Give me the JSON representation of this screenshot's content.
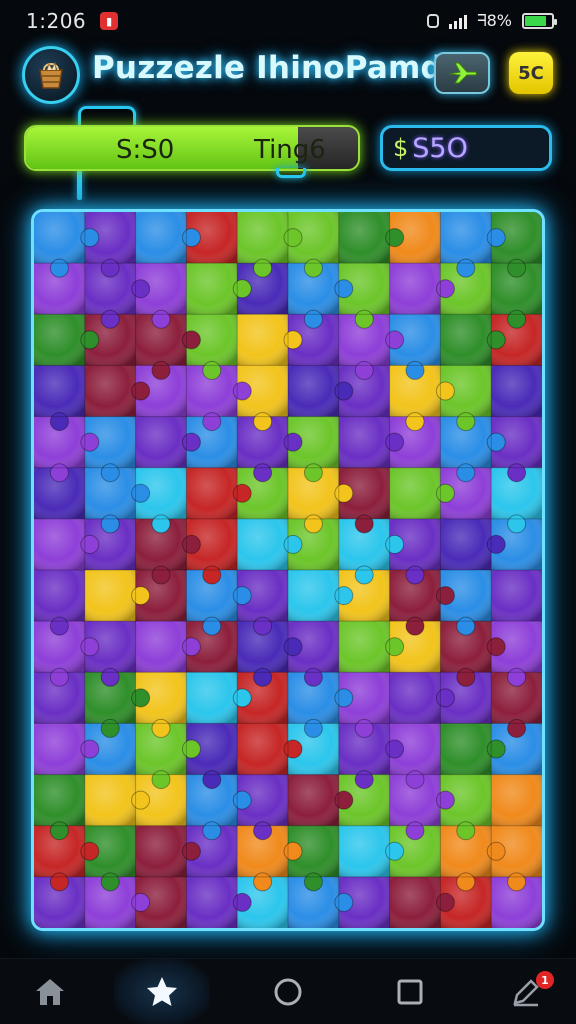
{
  "status_bar": {
    "time": "1:206",
    "notification_icon": "alert-badge-icon",
    "battery_text": "ᖷ8%",
    "battery_level": 0.8
  },
  "header": {
    "app_icon": "bucket-icon",
    "title": "Puzzezle IhinoPamd",
    "next_button_icon": "airplane-icon",
    "coin_label": "5C"
  },
  "progress": {
    "fill_fraction": 0.82,
    "score_label": "S:S0",
    "timer_label": "Ting6"
  },
  "money": {
    "symbol": "$",
    "amount": "S5O"
  },
  "board": {
    "rows": 12,
    "cols": 10,
    "palette": {
      "P": "#6a2fc4",
      "V": "#8e3fd8",
      "B": "#2b8ee6",
      "C": "#2cc6ec",
      "G": "#6cc62a",
      "D": "#2f8f2a",
      "Y": "#f2c41c",
      "O": "#f08a1c",
      "R": "#c62626",
      "M": "#8c1f3c",
      "I": "#4a2bb8"
    },
    "pieces": [
      "BPBRGGDOBD",
      "VPVGIBGVGD",
      "DMMGYPVBDR",
      "IMVVYIPYGI",
      "VBPBPGPVBP",
      "IBCRGYMGVC",
      "VPMRCGCPIB",
      "PYMBPCYMBP",
      "VPVMIPGYMV",
      "PDYCRBVPPM",
      "VBGIRCPVDB",
      "DYYBPMGVGO",
      "RDMPODCGOO",
      "PVMPCBPMRV"
    ]
  },
  "nav": {
    "items": [
      {
        "icon": "home-icon",
        "active": false
      },
      {
        "icon": "star-icon",
        "active": true
      },
      {
        "icon": "circle-icon",
        "active": false
      },
      {
        "icon": "square-icon",
        "active": false
      },
      {
        "icon": "edit-icon",
        "active": false,
        "badge": "1"
      }
    ]
  }
}
